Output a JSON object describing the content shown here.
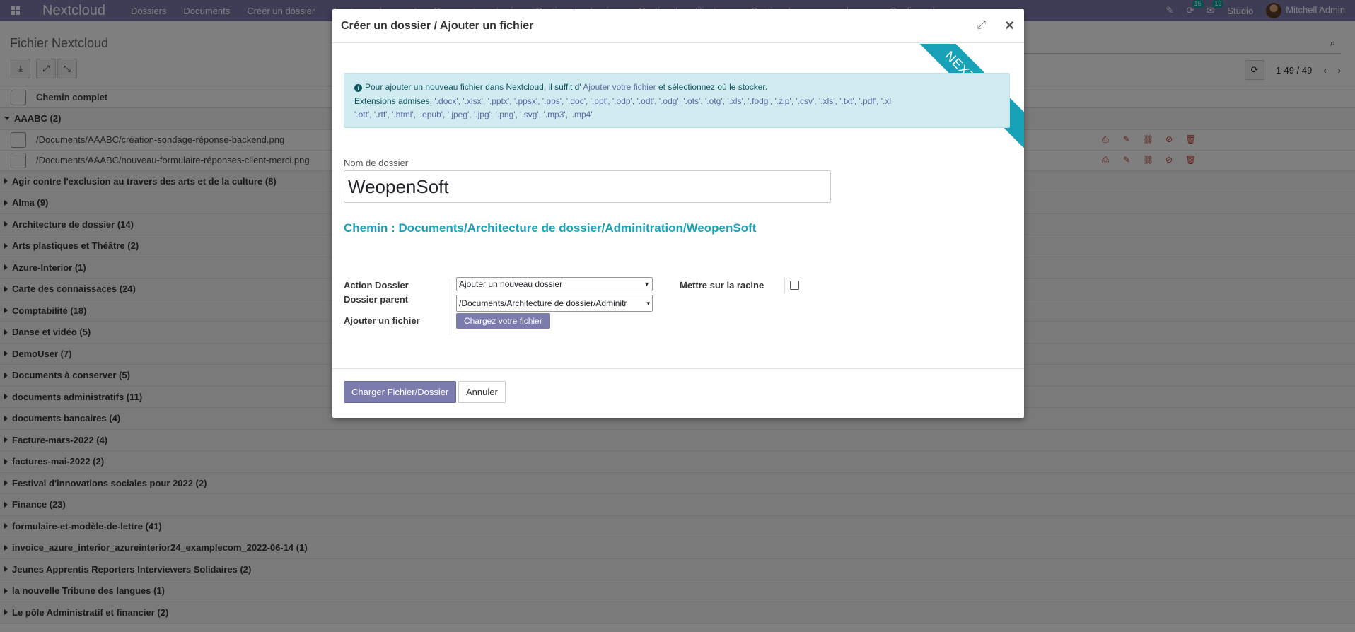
{
  "navbar": {
    "brand": "Nextcloud",
    "menu": [
      "Dossiers",
      "Documents",
      "Créer un dossier",
      "Ajouter un document",
      "Documents partagés",
      "Gestion des dossiers",
      "Gestion des utilisateurs",
      "Gestion des correspondances",
      "Configuration"
    ],
    "activity_badge": "16",
    "messages_badge": "19",
    "studio": "Studio",
    "user": "Mitchell Admin"
  },
  "control_panel": {
    "title": "Fichier Nextcloud",
    "pager": "1-49 / 49"
  },
  "list": {
    "header": "Chemin complet",
    "open_group": "AAABC (2)",
    "files": [
      "/Documents/AAABC/création-sondage-réponse-backend.png",
      "/Documents/AAABC/nouveau-formulaire-réponses-client-merci.png"
    ],
    "groups": [
      "Agir contre l'exclusion au travers des arts et de la culture (8)",
      "Alma (9)",
      "Architecture de dossier (14)",
      "Arts plastiques et Théâtre (2)",
      "Azure-Interior (1)",
      "Carte des connaissaces (24)",
      "Comptabilité (18)",
      "Danse et vidéo (5)",
      "DemoUser (7)",
      "Documents à conserver (5)",
      "documents administratifs (11)",
      "documents bancaires (4)",
      "Facture-mars-2022 (4)",
      "factures-mai-2022 (2)",
      "Festival d'innovations sociales pour 2022 (2)",
      "Finance (23)",
      "formulaire-et-modèle-de-lettre (41)",
      "invoice_azure_interior_azureinterior24_examplecom_2022-06-14 (1)",
      "Jeunes Apprentis Reporters Interviewers Solidaires (2)",
      "la nouvelle Tribune des langues (1)",
      "Le pôle Administratif et financier (2)"
    ]
  },
  "modal": {
    "title": "Créer un dossier / Ajouter un fichier",
    "ribbon": "NEXTCLOUD",
    "alert": {
      "text1": "Pour ajouter un nouveau fichier dans Nextcloud, il suffit d'",
      "link": "Ajouter votre fichier",
      "text2": "et sélectionnez où le stocker.",
      "ext_label": "Extensions admises:",
      "ext_line1": "'.docx', '.xlsx', '.pptx', '.ppsx', '.pps', '.doc', '.ppt', '.odp', '.odt', '.odg', '.ots', '.otg', '.xls', '.fodg', '.zip', '.csv', '.xls', '.txt', '.pdf', '.xl",
      "ext_line2": "'.ott', '.rtf', '.html', '.epub', '.jpeg', '.jpg', '.png', '.svg', '.mp3', '.mp4'"
    },
    "folder_name_label": "Nom de dossier",
    "folder_name_value": "WeopenSoft",
    "chemin": "Chemin : Documents/Architecture de dossier/Adminitration/WeopenSoft",
    "action_label": "Action Dossier",
    "action_value": "Ajouter un nouveau dossier",
    "parent_label": "Dossier parent",
    "parent_value": "/Documents/Architecture de dossier/Adminitr",
    "file_label": "Ajouter un fichier",
    "upload_button": "Chargez votre fichier",
    "root_label": "Mettre sur la racine",
    "submit_button": "Charger Fichier/Dossier",
    "cancel_button": "Annuler"
  }
}
